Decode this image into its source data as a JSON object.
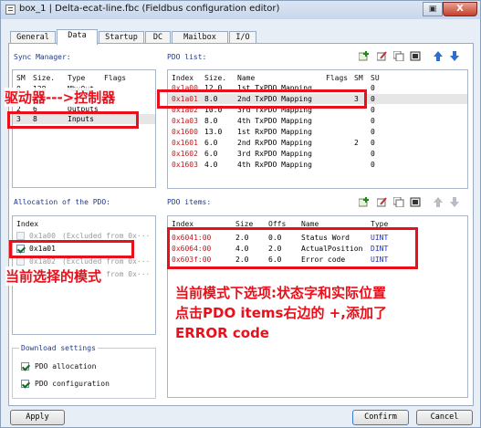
{
  "window": {
    "title": "box_1 | Delta-ecat-line.fbc (Fieldbus configuration editor)",
    "close_label": "X",
    "restore_label": "▣"
  },
  "tabs": [
    {
      "label": "General"
    },
    {
      "label": "Data"
    },
    {
      "label": "Startup"
    },
    {
      "label": "DC"
    },
    {
      "label": "Mailbox"
    },
    {
      "label": "I/O"
    }
  ],
  "sync_manager": {
    "label": "Sync Manager:",
    "columns": [
      "SM",
      "Size.",
      "Type",
      "Flags"
    ],
    "rows": [
      {
        "sm": "0",
        "size": "128",
        "type": "MbxOut",
        "flags": ""
      },
      {
        "sm": "1",
        "size": "128",
        "type": "MbxIn",
        "flags": ""
      },
      {
        "sm": "2",
        "size": "6",
        "type": "Outputs",
        "flags": ""
      },
      {
        "sm": "3",
        "size": "8",
        "type": "Inputs",
        "flags": ""
      }
    ],
    "annotation": "驱动器--->控制器"
  },
  "pdo_list": {
    "label": "PDO list:",
    "columns": [
      "Index",
      "Size.",
      "Name",
      "Flags",
      "SM",
      "SU"
    ],
    "rows": [
      {
        "index": "0x1a00",
        "size": "12.0",
        "name": "1st TxPDO Mapping",
        "flags": "",
        "sm": "",
        "su": "0"
      },
      {
        "index": "0x1a01",
        "size": "8.0",
        "name": "2nd TxPDO Mapping",
        "flags": "",
        "sm": "3",
        "su": "0"
      },
      {
        "index": "0x1a02",
        "size": "10.0",
        "name": "3rd TxPDO Mapping",
        "flags": "",
        "sm": "",
        "su": "0"
      },
      {
        "index": "0x1a03",
        "size": "8.0",
        "name": "4th TxPDO Mapping",
        "flags": "",
        "sm": "",
        "su": "0"
      },
      {
        "index": "0x1600",
        "size": "13.0",
        "name": "1st RxPDO Mapping",
        "flags": "",
        "sm": "",
        "su": "0"
      },
      {
        "index": "0x1601",
        "size": "6.0",
        "name": "2nd RxPDO Mapping",
        "flags": "",
        "sm": "2",
        "su": "0"
      },
      {
        "index": "0x1602",
        "size": "6.0",
        "name": "3rd RxPDO Mapping",
        "flags": "",
        "sm": "",
        "su": "0"
      },
      {
        "index": "0x1603",
        "size": "4.0",
        "name": "4th RxPDO Mapping",
        "flags": "",
        "sm": "",
        "su": "0"
      }
    ]
  },
  "allocation": {
    "label": "Allocation of the PDO:",
    "column": "Index",
    "items": [
      {
        "label": "0x1a00",
        "extra": "(Excluded from 0x···",
        "checked": false
      },
      {
        "label": "0x1a01",
        "extra": "",
        "checked": true
      },
      {
        "label": "0x1a02",
        "extra": "(Excluded from 0x···",
        "checked": false
      },
      {
        "label": "0x1a03",
        "extra": "(Excluded from 0x···",
        "checked": false
      }
    ],
    "annotation": "当前选择的模式"
  },
  "pdo_items": {
    "label": "PDO items:",
    "columns": [
      "Index",
      "Size",
      "Offs",
      "Name",
      "Type"
    ],
    "rows": [
      {
        "index": "0x6041:00",
        "size": "2.0",
        "offs": "0.0",
        "name": "Status Word",
        "type": "UINT"
      },
      {
        "index": "0x6064:00",
        "size": "4.0",
        "offs": "2.0",
        "name": "ActualPosition",
        "type": "DINT"
      },
      {
        "index": "0x603f:00",
        "size": "2.0",
        "offs": "6.0",
        "name": "Error code",
        "type": "UINT"
      }
    ],
    "annotation_lines": [
      "当前模式下选项:状态字和实际位置",
      "点击PDO items右边的 +,添加了",
      "ERROR code"
    ]
  },
  "download": {
    "label": "Download settings",
    "options": [
      {
        "label": "PDO allocation",
        "checked": true
      },
      {
        "label": "PDO configuration",
        "checked": true
      }
    ]
  },
  "buttons": {
    "apply": "Apply",
    "confirm": "Confirm",
    "cancel": "Cancel"
  },
  "colors": {
    "accent": "#e8101a",
    "index_red": "#c2181e",
    "uint_blue": "#1a2fbf"
  }
}
